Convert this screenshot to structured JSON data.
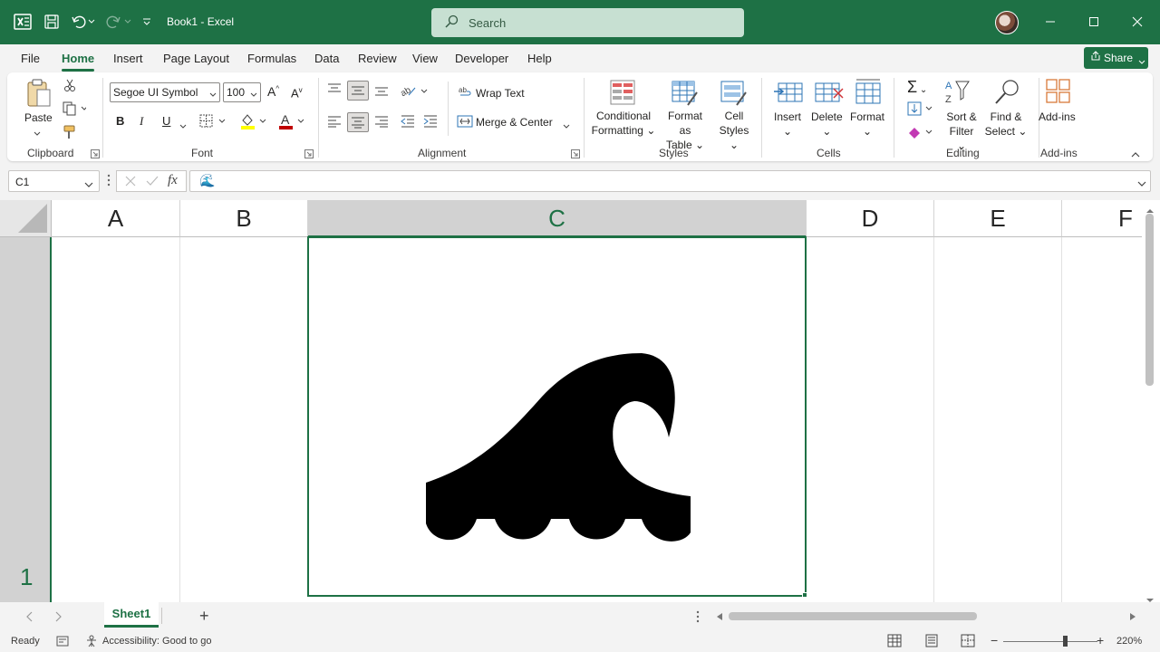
{
  "window": {
    "title": "Book1  -  Excel",
    "search_placeholder": "Search"
  },
  "menu": {
    "tabs": [
      "File",
      "Home",
      "Insert",
      "Page Layout",
      "Formulas",
      "Data",
      "Review",
      "View",
      "Developer",
      "Help"
    ],
    "active": "Home",
    "share_label": "Share"
  },
  "ribbon": {
    "clipboard": {
      "paste": "Paste",
      "label": "Clipboard"
    },
    "font": {
      "name": "Segoe UI Symbol",
      "size": "100",
      "bold": "B",
      "italic": "I",
      "underline": "U",
      "label": "Font"
    },
    "alignment": {
      "wrap": "Wrap Text",
      "merge": "Merge & Center",
      "label": "Alignment"
    },
    "styles": {
      "cond1": "Conditional",
      "cond2": "Formatting",
      "fmt1": "Format as",
      "fmt2": "Table",
      "cell1": "Cell",
      "cell2": "Styles",
      "label": "Styles"
    },
    "cells": {
      "insert": "Insert",
      "delete": "Delete",
      "format": "Format",
      "label": "Cells"
    },
    "editing": {
      "sort1": "Sort &",
      "sort2": "Filter",
      "find1": "Find &",
      "find2": "Select",
      "label": "Editing"
    },
    "addins": {
      "btn": "Add-ins",
      "label": "Add-ins"
    }
  },
  "formula_bar": {
    "name_box": "C1",
    "fx": "fx",
    "content": "🌊"
  },
  "grid": {
    "columns": [
      "A",
      "B",
      "C",
      "D",
      "E",
      "F"
    ],
    "selected_column": "C",
    "rows": [
      "1"
    ],
    "cell_C1": "🌊"
  },
  "sheets": {
    "tabs": [
      "Sheet1"
    ],
    "add": "+"
  },
  "status": {
    "ready": "Ready",
    "accessibility": "Accessibility: Good to go",
    "zoom": "220%"
  }
}
